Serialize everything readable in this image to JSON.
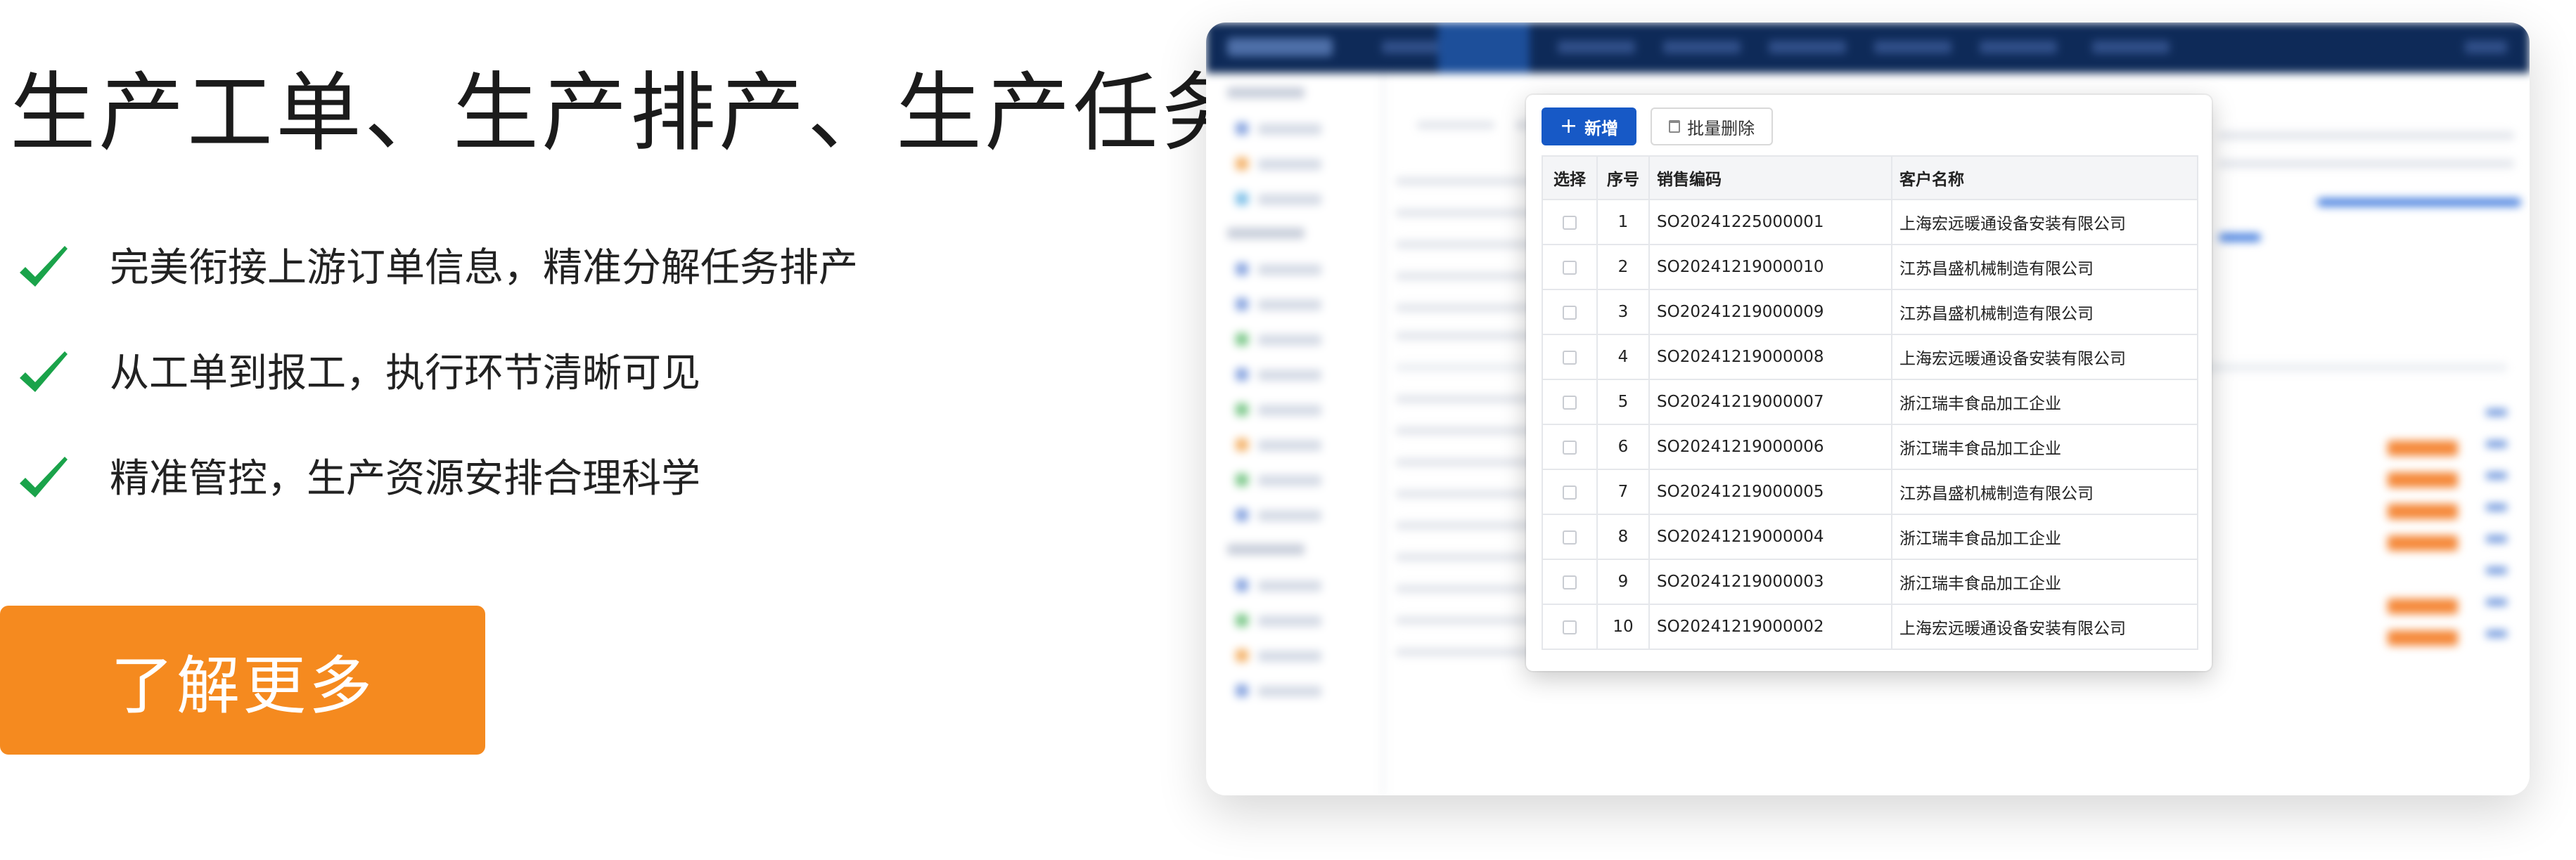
{
  "hero": {
    "headline": "生产工单、生产排产、生产任务",
    "features": [
      "完美衔接上游订单信息，精准分解任务排产",
      "从工单到报工，执行环节清晰可见",
      "精准管控，生产资源安排合理科学"
    ],
    "cta_label": "了解更多"
  },
  "popup": {
    "toolbar": {
      "add_label": "新增",
      "add_icon": "plus-icon",
      "delete_label": "批量删除",
      "delete_icon": "trash-icon"
    },
    "columns": {
      "select": "选择",
      "index": "序号",
      "code": "销售编码",
      "customer": "客户名称"
    },
    "rows": [
      {
        "index": "1",
        "code": "SO20241225000001",
        "customer": "上海宏远暖通设备安装有限公司"
      },
      {
        "index": "2",
        "code": "SO20241219000010",
        "customer": "江苏昌盛机械制造有限公司"
      },
      {
        "index": "3",
        "code": "SO20241219000009",
        "customer": "江苏昌盛机械制造有限公司"
      },
      {
        "index": "4",
        "code": "SO20241219000008",
        "customer": "上海宏远暖通设备安装有限公司"
      },
      {
        "index": "5",
        "code": "SO20241219000007",
        "customer": "浙江瑞丰食品加工企业"
      },
      {
        "index": "6",
        "code": "SO20241219000006",
        "customer": "浙江瑞丰食品加工企业"
      },
      {
        "index": "7",
        "code": "SO20241219000005",
        "customer": "江苏昌盛机械制造有限公司"
      },
      {
        "index": "8",
        "code": "SO20241219000004",
        "customer": "浙江瑞丰食品加工企业"
      },
      {
        "index": "9",
        "code": "SO20241219000003",
        "customer": "浙江瑞丰食品加工企业"
      },
      {
        "index": "10",
        "code": "SO20241219000002",
        "customer": "上海宏远暖通设备安装有限公司"
      }
    ]
  },
  "colors": {
    "check": "#1aa34a",
    "cta": "#f58a1f",
    "primary": "#1759c6",
    "link": "#1d56c2",
    "navbar": "#0e2a58"
  }
}
